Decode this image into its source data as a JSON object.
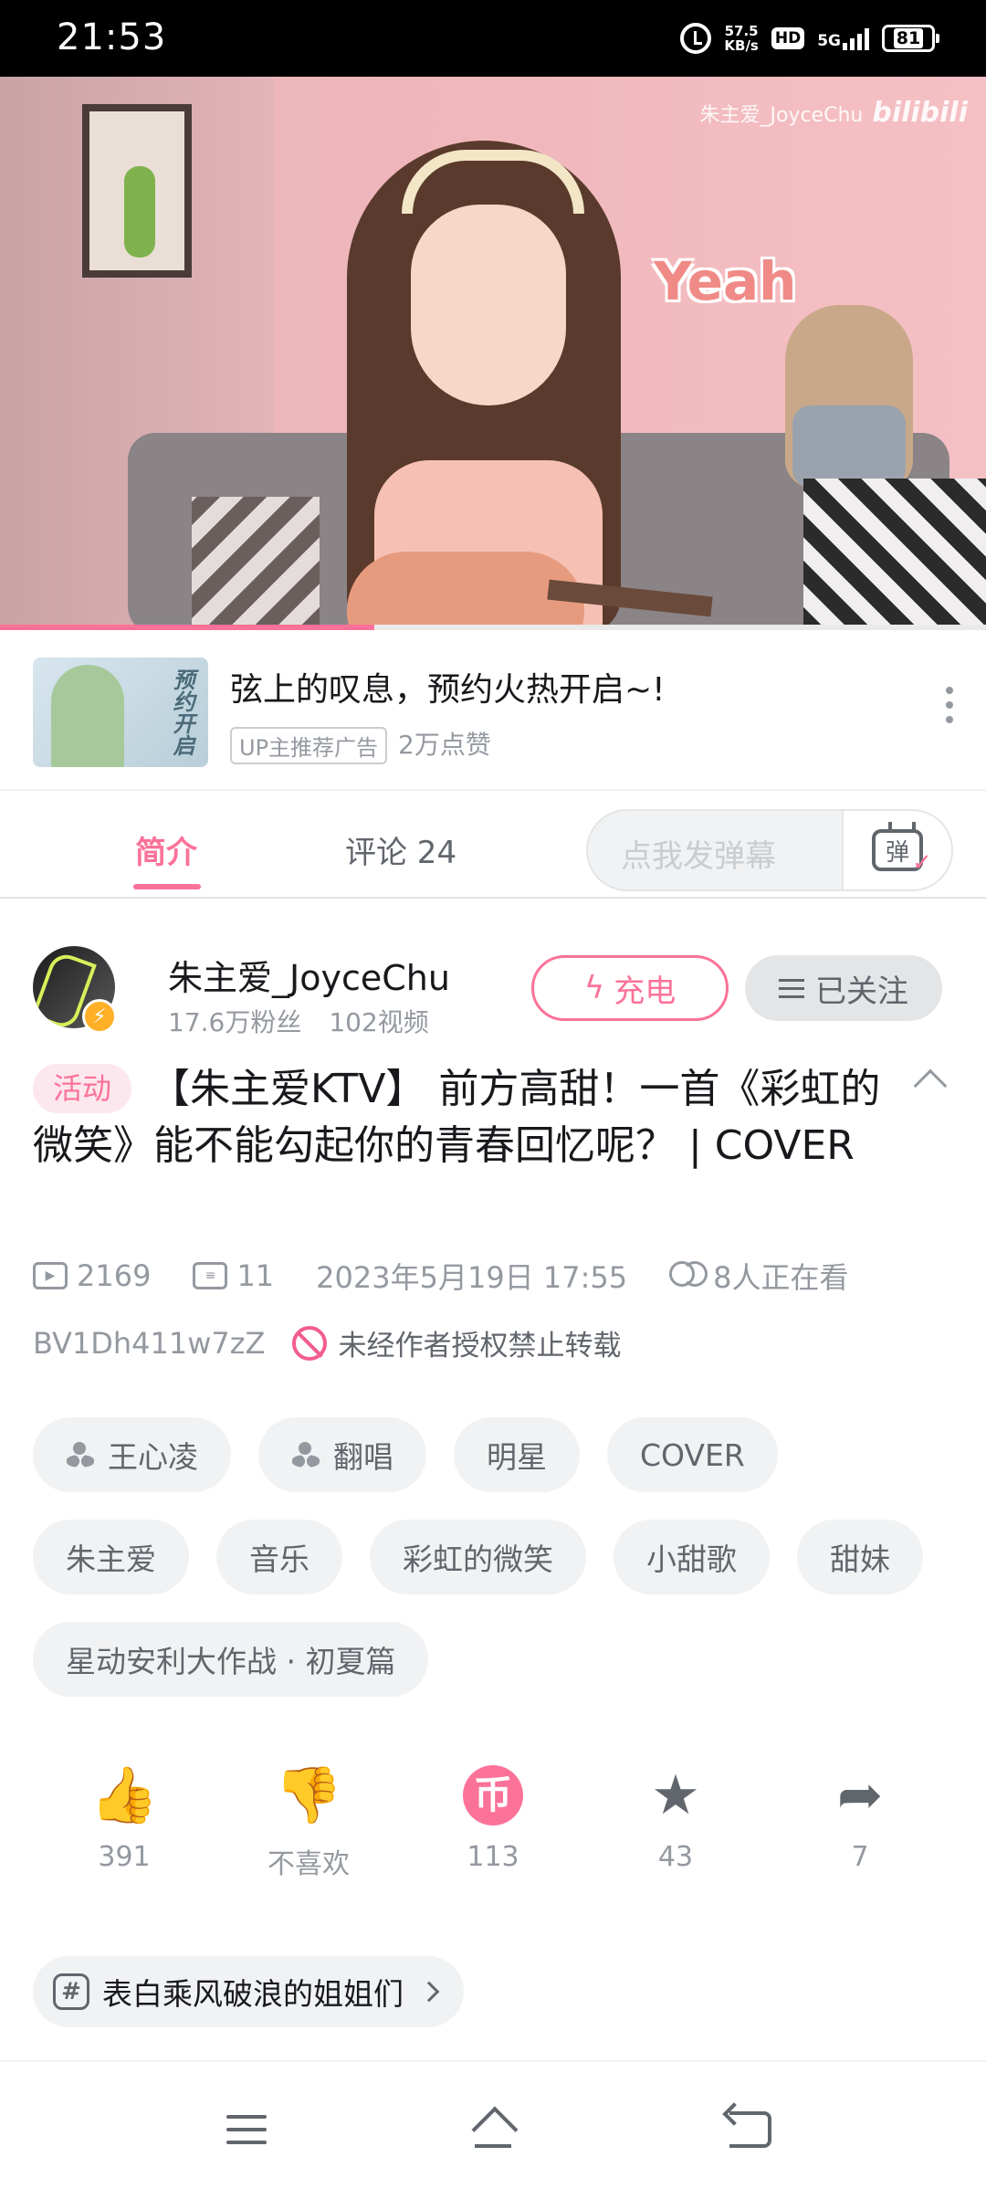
{
  "status_bar": {
    "time": "21:53",
    "net_speed_value": "57.5",
    "net_speed_unit": "KB/s",
    "hd": "HD",
    "network": "5G",
    "battery": "81"
  },
  "video": {
    "overlay_text": "Yeah",
    "watermark_name": "朱主爱_JoyceChu",
    "watermark_logo": "bilibili",
    "progress_fraction": 0.38
  },
  "ad": {
    "thumb_text": "预约开启",
    "title": "弦上的叹息，预约火热开启~!",
    "tag": "UP主推荐广告",
    "likes": "2万点赞"
  },
  "tabs": {
    "intro": "简介",
    "comments": "评论 24",
    "danmaku_placeholder": "点我发弹幕",
    "danmaku_button": "弹"
  },
  "uploader": {
    "name": "朱主爱_JoyceChu",
    "fans": "17.6万粉丝",
    "videos": "102视频",
    "charge_label": "充电",
    "follow_label": "已关注"
  },
  "video_info": {
    "activity_tag": "活动",
    "title": "【朱主爱KTV】 前方高甜！一首《彩虹的微笑》能不能勾起你的青春回忆呢？ | COVER",
    "views": "2169",
    "danmaku_count": "11",
    "date": "2023年5月19日  17:55",
    "watching": "8人正在看",
    "bvid": "BV1Dh411w7zZ",
    "copyright": "未经作者授权禁止转载"
  },
  "tags": [
    {
      "label": "王心凌",
      "people_icon": true
    },
    {
      "label": "翻唱",
      "people_icon": true
    },
    {
      "label": "明星",
      "people_icon": false
    },
    {
      "label": "COVER",
      "people_icon": false
    },
    {
      "label": "朱主爱",
      "people_icon": false
    },
    {
      "label": "音乐",
      "people_icon": false
    },
    {
      "label": "彩虹的微笑",
      "people_icon": false
    },
    {
      "label": "小甜歌",
      "people_icon": false
    },
    {
      "label": "甜妹",
      "people_icon": false
    },
    {
      "label": "星动安利大作战 · 初夏篇",
      "people_icon": false
    }
  ],
  "actions": {
    "like": "391",
    "dislike": "不喜欢",
    "coin": "113",
    "favorite": "43",
    "share": "7",
    "coin_glyph": "币"
  },
  "topic": {
    "label": "表白乘风破浪的姐姐们"
  },
  "colors": {
    "accent": "#fb7299",
    "text_primary": "#18191c",
    "text_secondary": "#9499a0",
    "chip_bg": "#f1f2f3"
  }
}
